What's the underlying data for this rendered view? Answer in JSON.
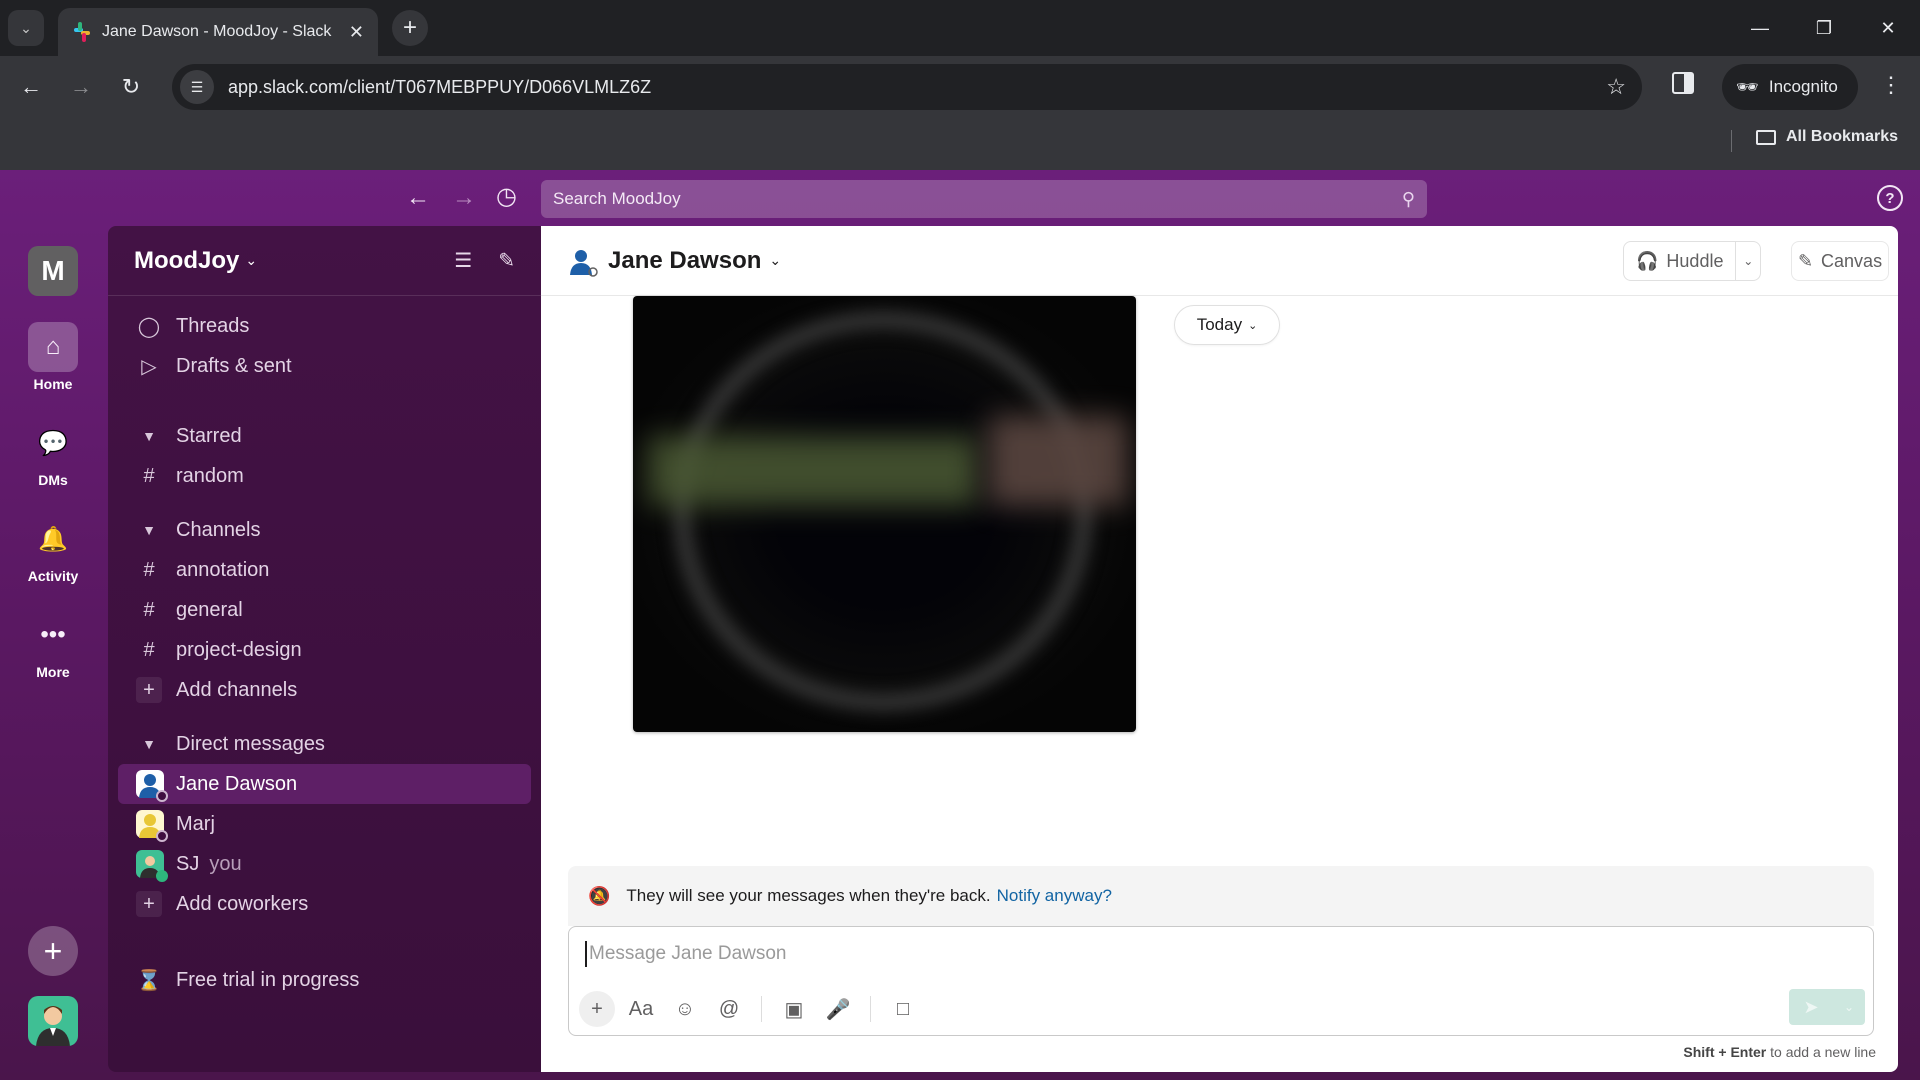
{
  "browser": {
    "tab_title": "Jane Dawson - MoodJoy - Slack",
    "url": "app.slack.com/client/T067MEBPPUY/D066VLMLZ6Z",
    "profile_label": "Incognito",
    "bookmarks_label": "All Bookmarks",
    "icons": {
      "tab_search": "chevron-down-icon",
      "new_tab": "plus-icon",
      "back": "arrow-left-icon",
      "forward": "arrow-right-icon",
      "reload": "reload-icon",
      "site_info": "tune-icon",
      "bookmark": "star-icon",
      "side_panel": "side-panel-icon",
      "menu": "kebab-icon"
    }
  },
  "slack": {
    "search_placeholder": "Search MoodJoy",
    "workspace": {
      "initial": "M",
      "name": "MoodJoy"
    },
    "rail": [
      {
        "label": "Home",
        "icon": "home-icon",
        "active": true
      },
      {
        "label": "DMs",
        "icon": "dms-icon",
        "active": false
      },
      {
        "label": "Activity",
        "icon": "bell-icon",
        "active": false
      },
      {
        "label": "More",
        "icon": "more-icon",
        "active": false
      }
    ],
    "sidebar": {
      "top_items": [
        {
          "label": "Threads",
          "icon": "threads-icon"
        },
        {
          "label": "Drafts & sent",
          "icon": "send-icon"
        }
      ],
      "starred": {
        "title": "Starred",
        "channels": [
          "random"
        ]
      },
      "channels": {
        "title": "Channels",
        "items": [
          "annotation",
          "general",
          "project-design"
        ],
        "add_label": "Add channels"
      },
      "direct_messages": {
        "title": "Direct messages",
        "items": [
          {
            "name": "Jane Dawson",
            "active": true,
            "avatar_color": "#1e5fa8"
          },
          {
            "name": "Marj",
            "active": false,
            "avatar_color": "#e8c736"
          },
          {
            "name": "SJ",
            "suffix": "you",
            "active": false,
            "avatar_color": "#3fbf94"
          }
        ],
        "add_label": "Add coworkers"
      },
      "trial_label": "Free trial in progress"
    },
    "channel": {
      "name": "Jane Dawson",
      "huddle_label": "Huddle",
      "canvas_label": "Canvas",
      "date_divider": "Today",
      "notice_text": "They will see your messages when they're back.",
      "notice_link": "Notify anyway?",
      "composer_placeholder": "Message Jane Dawson",
      "hint_key": "Shift + Enter",
      "hint_text": "to add a new line"
    },
    "colors": {
      "aubergine": "#4a154b",
      "link": "#1264a3",
      "send_disabled": "#cde7df"
    }
  }
}
